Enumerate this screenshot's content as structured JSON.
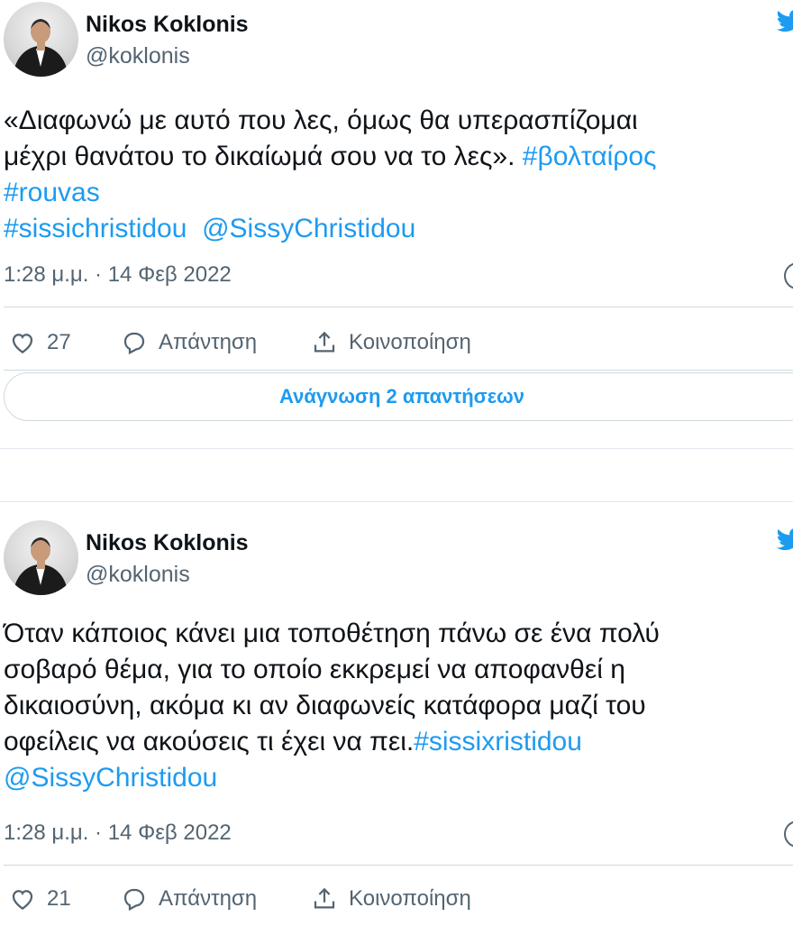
{
  "colors": {
    "link": "#1d9bf0",
    "secondary_text": "#536471",
    "border": "#cfd9de"
  },
  "tweets": [
    {
      "author_name": "Nikos Koklonis",
      "author_handle": "@koklonis",
      "body_lines": [
        [
          "«Διαφωνώ με αυτό που λες, όμως θα υπερασπίζομαι"
        ],
        [
          "μέχρι θανάτου το δικαίωμά σου να το λες». ",
          "#βολταίρος"
        ],
        [
          "#rouvas"
        ],
        [
          "#sissichristidou",
          "  @SissyChristidou"
        ]
      ],
      "timestamp": "1:28 μ.μ. · 14 Φεβ 2022",
      "like_count": "27",
      "reply_label": "Απάντηση",
      "share_label": "Κοινοποίηση",
      "read_replies_label": "Ανάγνωση 2 απαντήσεων"
    },
    {
      "author_name": "Nikos Koklonis",
      "author_handle": "@koklonis",
      "body_lines": [
        [
          "Όταν κάποιος κάνει μια τοποθέτηση πάνω σε ένα πολύ"
        ],
        [
          "σοβαρό θέμα, για το οποίο εκκρεμεί να αποφανθεί η"
        ],
        [
          "δικαιοσύνη, ακόμα κι αν διαφωνείς κατάφορα μαζί του"
        ],
        [
          "οφείλεις να ακούσεις τι έχει να πει.",
          "#sissixristidou"
        ],
        [
          "",
          "@SissyChristidou"
        ]
      ],
      "timestamp": "1:28 μ.μ. · 14 Φεβ 2022",
      "like_count": "21",
      "reply_label": "Απάντηση",
      "share_label": "Κοινοποίηση"
    }
  ],
  "icons": [
    "avatar",
    "twitter-bird-icon",
    "info-icon",
    "heart-icon",
    "reply-icon",
    "share-icon"
  ]
}
